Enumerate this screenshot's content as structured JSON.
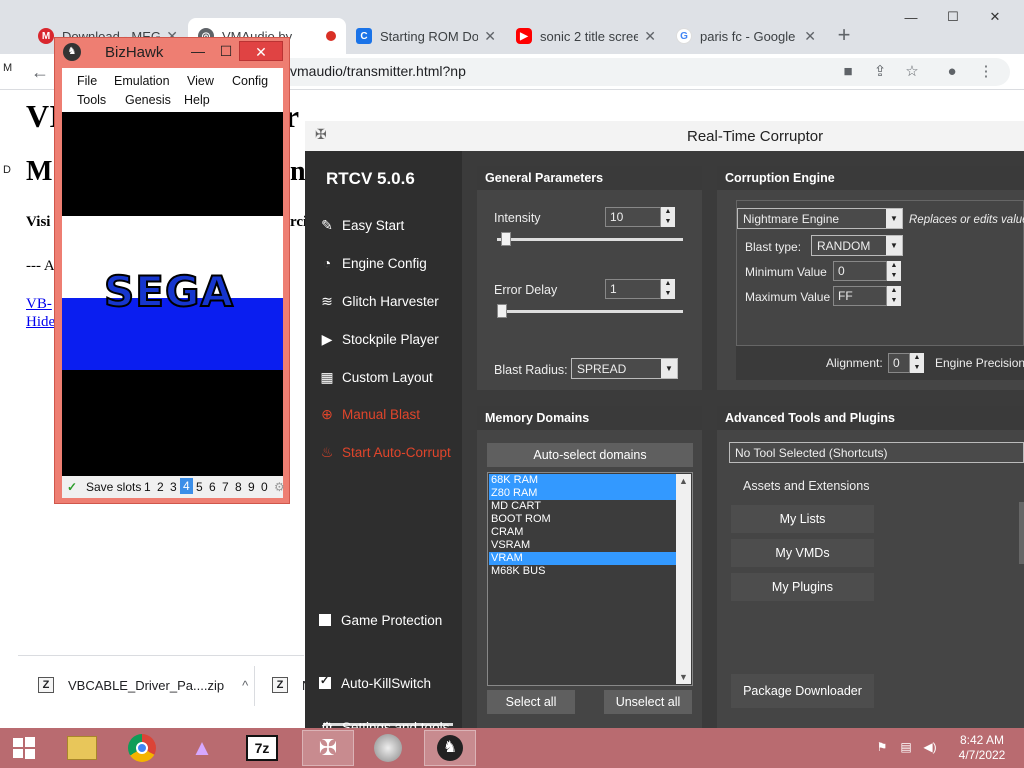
{
  "chrome": {
    "tabs": [
      {
        "title": "Download - MEGA",
        "favicon": "mega-icon",
        "color": "#d9272e"
      },
      {
        "title": "VMAudio by",
        "favicon": "globe-icon",
        "color": "#5f6368",
        "recording": true
      },
      {
        "title": "Starting ROM Do",
        "favicon": "c-icon",
        "color": "#1a73e8"
      },
      {
        "title": "sonic 2 title scree",
        "favicon": "youtube-icon",
        "color": "#ff0000"
      },
      {
        "title": "paris fc - Google",
        "favicon": "google-icon",
        "color": "#4285f4"
      }
    ],
    "new_tab": "+",
    "url": "vmaudio/transmitter.html?np",
    "page": {
      "h1_left": "VI",
      "h1_right": "ter",
      "h2_left": "M",
      "h2_right": "nc",
      "visit_left": "Visi",
      "visit_right": "rci",
      "dash": "--- A",
      "link1": "VB-",
      "link2": "Hide"
    },
    "left_marks": [
      "M",
      "D"
    ],
    "downloads": [
      {
        "name": "VBCABLE_Driver_Pa....zip",
        "chevron": "^"
      },
      {
        "name": "N"
      }
    ]
  },
  "bizhawk": {
    "title": "BizHawk",
    "menu_row1": [
      "File",
      "Emulation",
      "View",
      "Config"
    ],
    "menu_row2": [
      "Tools",
      "Genesis",
      "Help"
    ],
    "screen_text": "SEGA",
    "save_slots_label": "Save slots",
    "slots": [
      "1",
      "2",
      "3",
      "4",
      "5",
      "6",
      "7",
      "8",
      "9",
      "0"
    ],
    "selected_slot": "4"
  },
  "rtc": {
    "title": "Real-Time Corruptor",
    "version": "RTCV 5.0.6",
    "sidebar": [
      {
        "label": "Easy Start",
        "icon": "wand-icon"
      },
      {
        "label": "Engine Config",
        "icon": "gauge-icon"
      },
      {
        "label": "Glitch Harvester",
        "icon": "layers-icon"
      },
      {
        "label": "Stockpile Player",
        "icon": "play-icon"
      },
      {
        "label": "Custom Layout",
        "icon": "grid-icon"
      },
      {
        "label": "Manual Blast",
        "icon": "crosshair-icon"
      },
      {
        "label": "Start Auto-Corrupt",
        "icon": "flame-icon"
      }
    ],
    "game_protection": "Game Protection",
    "auto_killswitch": "Auto-KillSwitch",
    "settings": "Settings and tools",
    "general": {
      "header": "General Parameters",
      "intensity_label": "Intensity",
      "intensity_value": "10",
      "intensity_level": 0.02,
      "error_delay_label": "Error Delay",
      "error_delay_value": "1",
      "error_delay_level": 0.0,
      "blast_radius_label": "Blast Radius:",
      "blast_radius_value": "SPREAD"
    },
    "engine": {
      "header": "Corruption Engine",
      "engine_value": "Nightmare Engine",
      "engine_desc": "Replaces or edits values",
      "blast_type_label": "Blast type:",
      "blast_type_value": "RANDOM",
      "min_label": "Minimum Value",
      "min_value": "0",
      "max_label": "Maximum Value",
      "max_value": "FF",
      "alignment_label": "Alignment:",
      "alignment_value": "0",
      "precision_label": "Engine Precision:"
    },
    "memory": {
      "header": "Memory Domains",
      "auto_select": "Auto-select domains",
      "domains": [
        {
          "name": "68K RAM",
          "selected": true
        },
        {
          "name": "Z80 RAM",
          "selected": true
        },
        {
          "name": "MD CART",
          "selected": false
        },
        {
          "name": "BOOT ROM",
          "selected": false
        },
        {
          "name": "CRAM",
          "selected": false
        },
        {
          "name": "VSRAM",
          "selected": false
        },
        {
          "name": "VRAM",
          "selected": true
        },
        {
          "name": "M68K BUS",
          "selected": false
        }
      ],
      "select_all": "Select all",
      "unselect_all": "Unselect all"
    },
    "advanced": {
      "header": "Advanced Tools and Plugins",
      "tool_value": "No Tool Selected (Shortcuts)",
      "assets_label": "Assets and Extensions",
      "buttons": [
        "My Lists",
        "My VMDs",
        "My Plugins"
      ],
      "package_downloader": "Package Downloader"
    }
  },
  "taskbar": {
    "apps": [
      "file-explorer-icon",
      "chrome-icon",
      "vmaudio-icon",
      "7zip-icon",
      "rtc-icon",
      "speaker-app-icon",
      "bizhawk-icon"
    ],
    "time": "8:42 AM",
    "date": "4/7/2022",
    "accent": "#b96b70"
  }
}
